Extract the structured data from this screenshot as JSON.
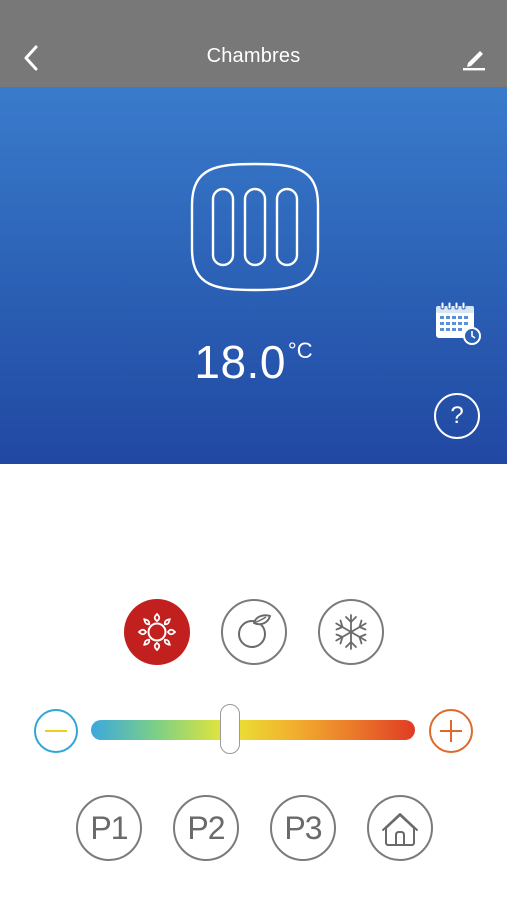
{
  "header": {
    "title": "Chambres",
    "back_icon": "chevron-left-icon",
    "edit_icon": "pencil-icon"
  },
  "status": {
    "device_icon": "radiator-icon",
    "temperature": "18.0",
    "unit": "°C",
    "calendar_icon": "calendar-clock-icon",
    "help_label": "?"
  },
  "modes": [
    {
      "name": "comfort",
      "icon": "sun-icon",
      "active": true
    },
    {
      "name": "eco",
      "icon": "leaf-icon",
      "active": false
    },
    {
      "name": "frost-protection",
      "icon": "snowflake-icon",
      "active": false
    }
  ],
  "slider": {
    "level": 0.43,
    "minus_icon": "minus-icon",
    "plus_icon": "plus-icon"
  },
  "presets": [
    {
      "label": "P1"
    },
    {
      "label": "P2"
    },
    {
      "label": "P3"
    },
    {
      "label": "",
      "icon": "home-icon"
    }
  ],
  "colors": {
    "header_bg": "#787878",
    "hero_top": "#3a7bcc",
    "hero_bottom": "#2148a2",
    "active_mode": "#c21f1f",
    "minus_ring": "#2fa5d8",
    "plus_ring": "#e0682a"
  }
}
